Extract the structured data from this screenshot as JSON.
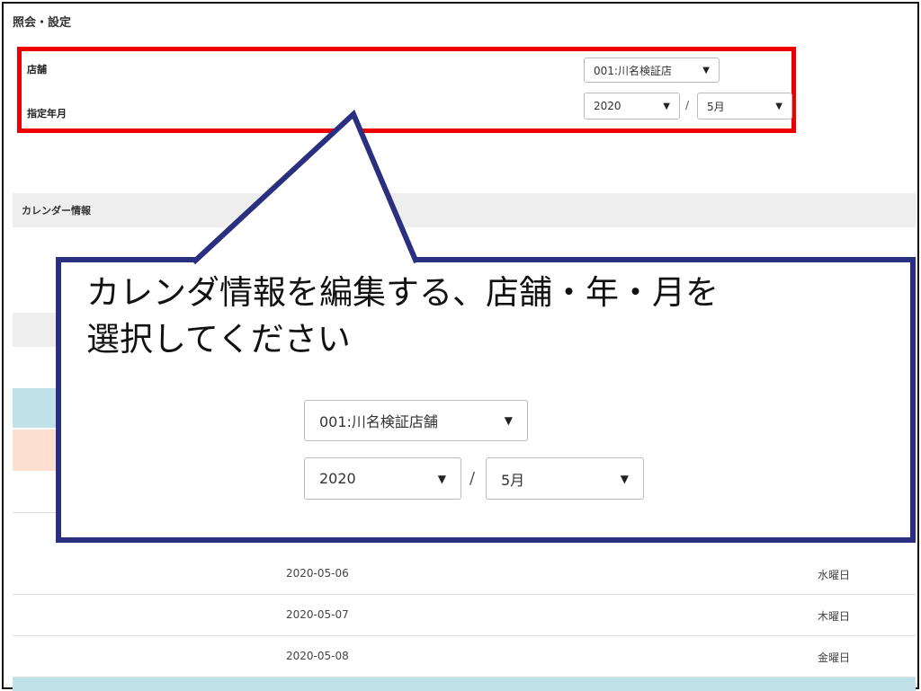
{
  "page": {
    "title": "照会・設定"
  },
  "filter": {
    "store_label": "店舗",
    "store_value": "001:川名検証店",
    "month_label": "指定年月",
    "year_value": "2020",
    "slash": "/",
    "month_value": "5月"
  },
  "section": {
    "calendar_title": "カレンダー情報"
  },
  "rows": [
    {
      "date": "2020-05-06",
      "dow": "水曜日"
    },
    {
      "date": "2020-05-07",
      "dow": "木曜日"
    },
    {
      "date": "2020-05-08",
      "dow": "金曜日"
    }
  ],
  "callout": {
    "text": "カレンダ情報を編集する、店舗・年・月を\n選択してください",
    "store_value": "001:川名検証店舗",
    "year_value": "2020",
    "slash": "/",
    "month_value": "5月"
  },
  "icons": {
    "dropdown": "caret-down-icon"
  },
  "colors": {
    "highlight_border": "#ee0000",
    "callout_border": "#2b2f80",
    "header_bg": "#eeeeee",
    "blue_row": "#bfe1e7",
    "peach_row": "#fde0d2"
  }
}
